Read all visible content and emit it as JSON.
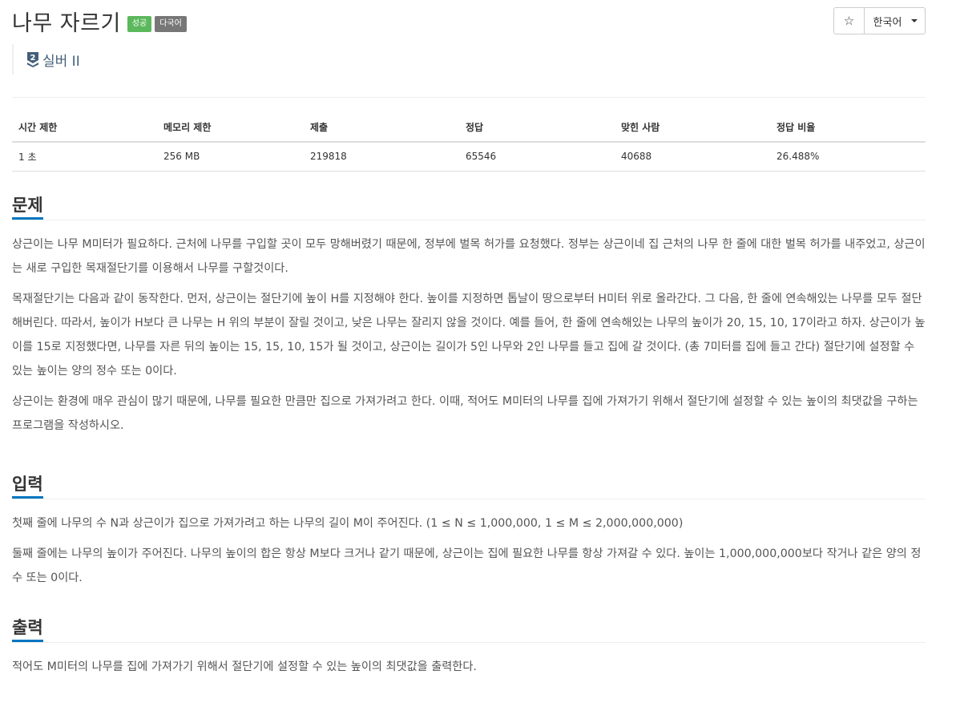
{
  "problem": {
    "title": "나무 자르기",
    "badges": {
      "success": "성공",
      "multilang": "다국어"
    },
    "tier": {
      "number": "2",
      "label": "실버 II"
    }
  },
  "actions": {
    "star_icon": "star-icon",
    "star_glyph": "☆",
    "language": "한국어"
  },
  "stats": {
    "headers": [
      "시간 제한",
      "메모리 제한",
      "제출",
      "정답",
      "맞힌 사람",
      "정답 비율"
    ],
    "values": [
      "1 초",
      "256 MB",
      "219818",
      "65546",
      "40688",
      "26.488%"
    ]
  },
  "sections": {
    "problem": {
      "title": "문제",
      "paragraphs": [
        "상근이는 나무 M미터가 필요하다. 근처에 나무를 구입할 곳이 모두 망해버렸기 때문에, 정부에 벌목 허가를 요청했다. 정부는 상근이네 집 근처의 나무 한 줄에 대한 벌목 허가를 내주었고, 상근이는 새로 구입한 목재절단기를 이용해서 나무를 구할것이다.",
        "목재절단기는 다음과 같이 동작한다. 먼저, 상근이는 절단기에 높이 H를 지정해야 한다. 높이를 지정하면 톱날이 땅으로부터 H미터 위로 올라간다. 그 다음, 한 줄에 연속해있는 나무를 모두 절단해버린다. 따라서, 높이가 H보다 큰 나무는 H 위의 부분이 잘릴 것이고, 낮은 나무는 잘리지 않을 것이다. 예를 들어, 한 줄에 연속해있는 나무의 높이가 20, 15, 10, 17이라고 하자. 상근이가 높이를 15로 지정했다면, 나무를 자른 뒤의 높이는 15, 15, 10, 15가 될 것이고, 상근이는 길이가 5인 나무와 2인 나무를 들고 집에 갈 것이다. (총 7미터를 집에 들고 간다) 절단기에 설정할 수 있는 높이는 양의 정수 또는 0이다.",
        "상근이는 환경에 매우 관심이 많기 때문에, 나무를 필요한 만큼만 집으로 가져가려고 한다. 이때, 적어도 M미터의 나무를 집에 가져가기 위해서 절단기에 설정할 수 있는 높이의 최댓값을 구하는 프로그램을 작성하시오."
      ]
    },
    "input": {
      "title": "입력",
      "paragraphs": [
        "첫째 줄에 나무의 수 N과 상근이가 집으로 가져가려고 하는 나무의 길이 M이 주어진다. (1 ≤ N ≤ 1,000,000, 1 ≤ M ≤ 2,000,000,000)",
        "둘째 줄에는 나무의 높이가 주어진다. 나무의 높이의 합은 항상 M보다 크거나 같기 때문에, 상근이는 집에 필요한 나무를 항상 가져갈 수 있다. 높이는 1,000,000,000보다 작거나 같은 양의 정수 또는 0이다."
      ]
    },
    "output": {
      "title": "출력",
      "paragraphs": [
        "적어도 M미터의 나무를 집에 가져가기 위해서 절단기에 설정할 수 있는 높이의 최댓값을 출력한다."
      ]
    }
  },
  "colors": {
    "success": "#5cb85c",
    "multilang": "#777777",
    "tier": "#435f7a",
    "accent": "#0076c0"
  }
}
